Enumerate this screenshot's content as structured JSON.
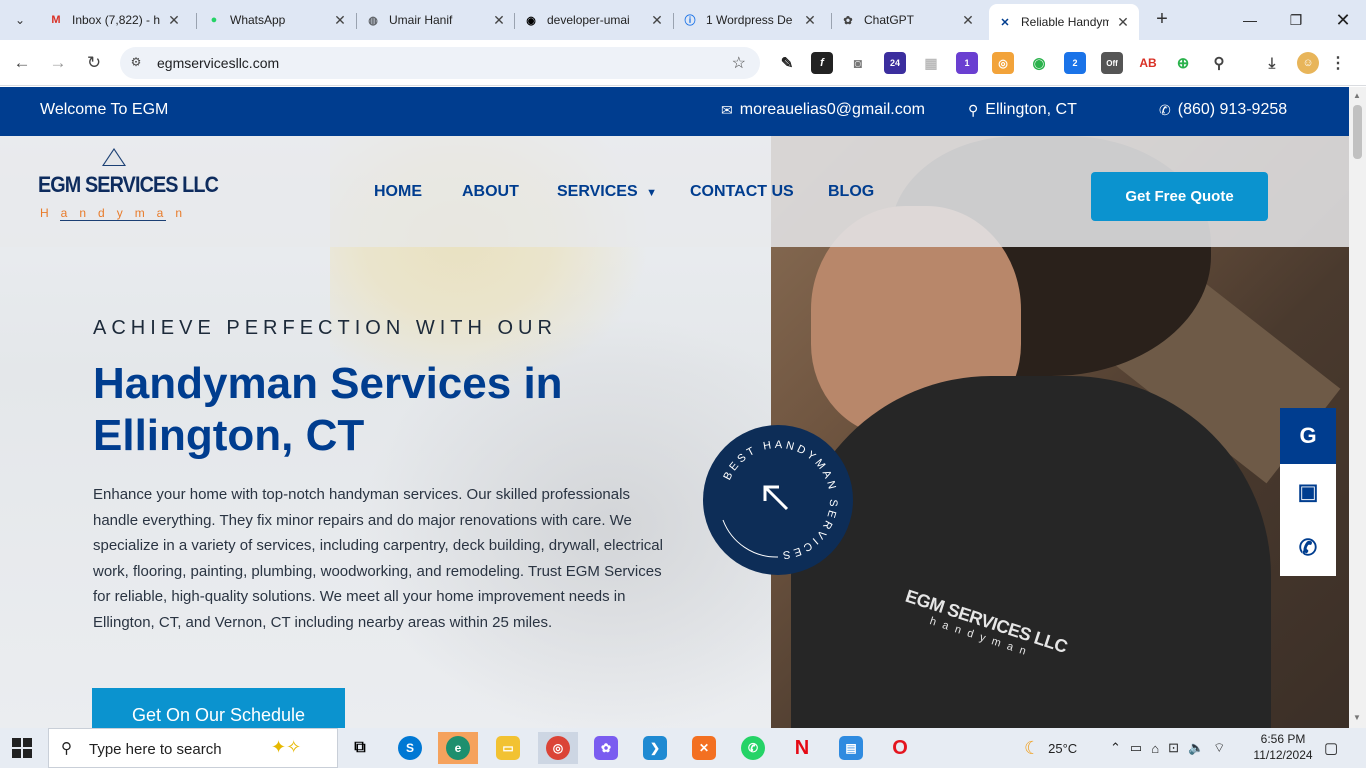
{
  "browser": {
    "tabs": [
      {
        "title": "Inbox (7,822) - h",
        "icon": "gmail-icon",
        "color": "#d93025"
      },
      {
        "title": "WhatsApp",
        "icon": "whatsapp-icon",
        "color": "#25d366"
      },
      {
        "title": "Umair Hanif",
        "icon": "globe-icon",
        "color": "#5f6368"
      },
      {
        "title": "developer-umai",
        "icon": "github-icon",
        "color": "#000000"
      },
      {
        "title": "1 Wordpress De",
        "icon": "info-icon",
        "color": "#1a73e8"
      },
      {
        "title": "ChatGPT",
        "icon": "openai-icon",
        "color": "#444444"
      },
      {
        "title": "Reliable Handym",
        "icon": "tools-icon",
        "color": "#003d8f"
      }
    ],
    "url": "egmservicesllc.com",
    "extension_badges": [
      "24",
      "1",
      "2",
      "Off"
    ]
  },
  "site": {
    "colors": {
      "primary": "#003d8f",
      "accent": "#0b93cf",
      "orange": "#e87b2a"
    },
    "topbar": {
      "welcome": "Welcome To EGM",
      "email": "moreauelias0@gmail.com",
      "location": "Ellington, CT",
      "phone": "(860) 913-9258"
    },
    "logo": {
      "name": "EGM SERVICES LLC",
      "tagline": "Handyman"
    },
    "nav": {
      "home": "HOME",
      "about": "ABOUT",
      "services": "SERVICES",
      "contact": "CONTACT US",
      "blog": "BLOG",
      "quote_button": "Get Free Quote"
    },
    "hero": {
      "eyebrow": "ACHIEVE PERFECTION WITH OUR",
      "headline_line1": "Handyman Services in",
      "headline_line2": "Ellington, CT",
      "body": "Enhance your home with top-notch handyman services. Our skilled professionals handle everything. They fix minor repairs and do major renovations with care. We specialize in a variety of services, including carpentry, deck building, drywall, electrical work, flooring, painting, plumbing, woodworking, and remodeling. Trust EGM Services for reliable, high-quality solutions. We meet all your home improvement needs in Ellington, CT, and Vernon, CT including nearby areas within 25 miles.",
      "cta": "Get On Our Schedule",
      "badge_text": "BEST HANDYMAN SERVICES",
      "hoodie_line1": "EGM SERVICES LLC",
      "hoodie_line2": "handyman"
    },
    "side_buttons": [
      {
        "icon": "google-icon",
        "label": "G"
      },
      {
        "icon": "clipboard-icon",
        "label": "📋"
      },
      {
        "icon": "phone-icon",
        "label": "✆"
      }
    ]
  },
  "taskbar": {
    "search_placeholder": "Type here to search",
    "weather_temp": "25°C",
    "time": "6:56 PM",
    "date": "11/12/2024"
  }
}
